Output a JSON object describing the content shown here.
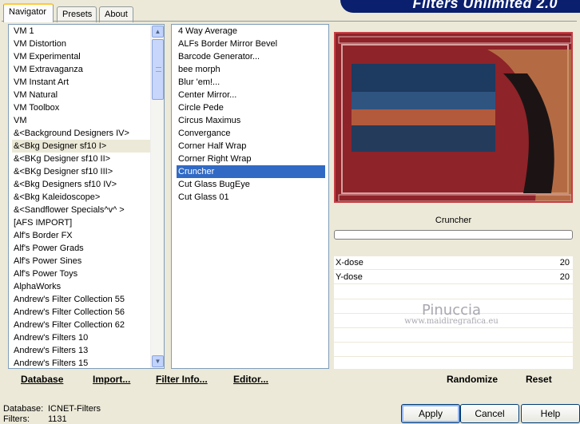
{
  "tabs": [
    "Navigator",
    "Presets",
    "About"
  ],
  "banner": "Filters Unlimited 2.0",
  "categories": [
    "VM 1",
    "VM Distortion",
    "VM Experimental",
    "VM Extravaganza",
    "VM Instant Art",
    "VM Natural",
    "VM Toolbox",
    "VM",
    "&<Background Designers IV>",
    "&<Bkg Designer sf10 I>",
    "&<BKg Designer sf10 II>",
    "&<BKg Designer sf10 III>",
    "&<Bkg Designers sf10 IV>",
    "&<Bkg Kaleidoscope>",
    "&<Sandflower Specials^v^ >",
    "[AFS IMPORT]",
    "Alf's Border FX",
    "Alf's Power Grads",
    "Alf's Power Sines",
    "Alf's Power Toys",
    "AlphaWorks",
    "Andrew's Filter Collection 55",
    "Andrew's Filter Collection 56",
    "Andrew's Filter Collection 62",
    "Andrew's Filters 10",
    "Andrew's Filters 13",
    "Andrew's Filters 15"
  ],
  "selected_category": "&<Bkg Designer sf10 I>",
  "filters": [
    "4 Way Average",
    "ALFs Border Mirror Bevel",
    "Barcode Generator...",
    "bee morph",
    "Blur 'em!...",
    "Center Mirror...",
    "Circle Pede",
    "Circus Maximus",
    "Convergance",
    "Corner Half Wrap",
    "Corner Right Wrap",
    "Cruncher",
    "Cut Glass  BugEye",
    "Cut Glass 01"
  ],
  "selected_filter": "Cruncher",
  "filter_name": "Cruncher",
  "params": [
    {
      "label": "X-dose",
      "value": "20"
    },
    {
      "label": "Y-dose",
      "value": "20"
    }
  ],
  "watermark": {
    "name": "Pinuccia",
    "site": "www.maidiregrafica.eu"
  },
  "left_buttons": [
    "Database",
    "Import...",
    "Filter Info...",
    "Editor..."
  ],
  "right_buttons": [
    "Randomize",
    "Reset"
  ],
  "status": {
    "database_label": "Database:",
    "database_value": "ICNET-Filters",
    "filters_label": "Filters:",
    "filters_value": "1131"
  },
  "dialog_buttons": {
    "apply": "Apply",
    "cancel": "Cancel",
    "help": "Help"
  }
}
